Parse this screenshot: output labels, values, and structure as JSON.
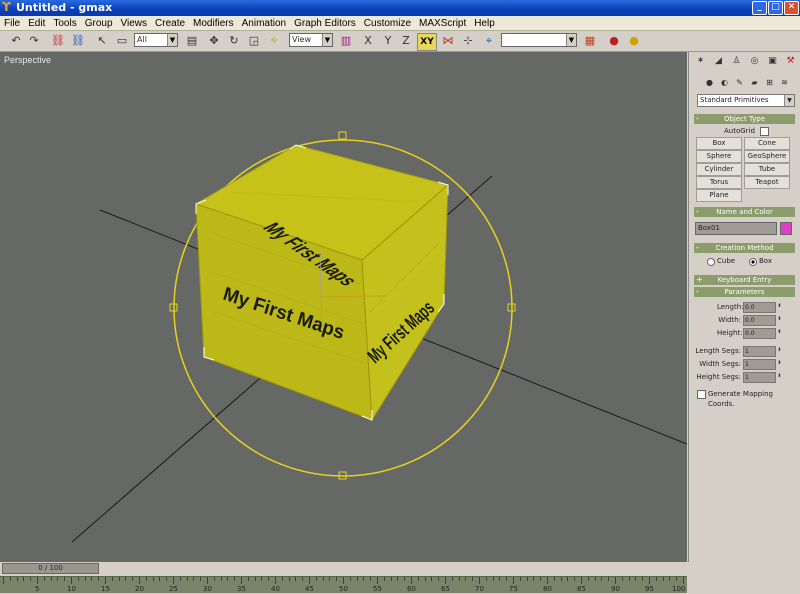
{
  "window": {
    "title": "Untitled - gmax",
    "minimize": "_",
    "maximize": "□",
    "close": "✕"
  },
  "menu": [
    "File",
    "Edit",
    "Tools",
    "Group",
    "Views",
    "Create",
    "Modifiers",
    "Animation",
    "Graph Editors",
    "Customize",
    "MAXScript",
    "Help"
  ],
  "toolbar": {
    "selection_filter": "All",
    "ref_coord": "View",
    "constraint_xy": "XY",
    "named_selection": ""
  },
  "viewport": {
    "label": "Perspective",
    "box_text": "My First Maps"
  },
  "command_panel": {
    "category": "Standard Primitives",
    "object_type": {
      "header": "Object Type",
      "autogrid_label": "AutoGrid",
      "buttons": [
        "Box",
        "Cone",
        "Sphere",
        "GeoSphere",
        "Cylinder",
        "Tube",
        "Torus",
        "Teapot",
        "Plane"
      ]
    },
    "name_color": {
      "header": "Name and Color",
      "name": "Box01",
      "color": "#e040c8"
    },
    "creation_method": {
      "header": "Creation Method",
      "options": [
        "Cube",
        "Box"
      ],
      "selected": "Box"
    },
    "keyboard_entry": {
      "header": "Keyboard Entry"
    },
    "parameters": {
      "header": "Parameters",
      "fields": [
        {
          "label": "Length:",
          "value": "0.0"
        },
        {
          "label": "Width:",
          "value": "0.0"
        },
        {
          "label": "Height:",
          "value": "0.0"
        }
      ],
      "segs": [
        {
          "label": "Length Segs:",
          "value": "1"
        },
        {
          "label": "Width Segs:",
          "value": "1"
        },
        {
          "label": "Height Segs:",
          "value": "1"
        }
      ],
      "gen_mapping_label": "Generate Mapping Coords."
    }
  },
  "timeline": {
    "slider_text": "0 / 100",
    "ticks": [
      "5",
      "10",
      "15",
      "20",
      "25",
      "30",
      "35",
      "40",
      "45",
      "50",
      "55",
      "60",
      "65",
      "70",
      "75",
      "80",
      "85",
      "90",
      "95",
      "100"
    ]
  },
  "colors": {
    "accent": "#8c9c6c",
    "box_face": "#c8c41c",
    "viewport_bg": "#666866",
    "gizmo": "#e6d21c"
  }
}
